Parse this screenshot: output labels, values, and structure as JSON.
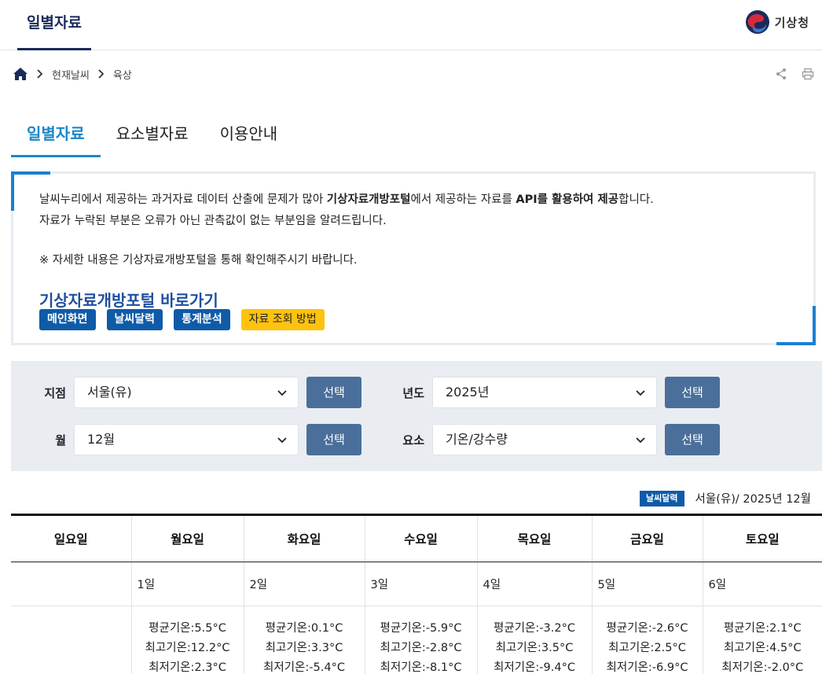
{
  "header": {
    "title": "일별자료",
    "org": "기상청"
  },
  "breadcrumb": {
    "items": [
      "현재날씨",
      "육상"
    ]
  },
  "tabs": [
    {
      "label": "일별자료",
      "active": true
    },
    {
      "label": "요소별자료",
      "active": false
    },
    {
      "label": "이용안내",
      "active": false
    }
  ],
  "notice": {
    "l1_a": "날씨누리에서 제공하는 과거자료 데이터 산출에 문제가 많아 ",
    "l1_b": "기상자료개방포털",
    "l1_c": "에서 제공하는 자료를 ",
    "l1_d": "API를 활용하여 제공",
    "l1_e": "합니다.",
    "l2": "자료가 누락된 부분은 오류가 아닌 관측값이 없는 부분임을 알려드립니다.",
    "l3": "※ 자세한 내용은 기상자료개방포털을 통해 확인해주시기 바랍니다.",
    "portal_title": "기상자료개방포털 바로가기",
    "chips": [
      "메인화면",
      "날씨달력",
      "통계분석",
      "자료 조회 방법"
    ]
  },
  "filter": {
    "station_label": "지점",
    "station_value": "서울(유)",
    "year_label": "년도",
    "year_value": "2025년",
    "month_label": "월",
    "month_value": "12월",
    "element_label": "요소",
    "element_value": "기온/강수량",
    "button_label": "선택"
  },
  "caption": {
    "badge": "날씨달력",
    "text": "서울(유)/ 2025년 12월"
  },
  "calendar": {
    "weekdays": [
      "일요일",
      "월요일",
      "화요일",
      "수요일",
      "목요일",
      "금요일",
      "토요일"
    ],
    "days": [
      "",
      "1일",
      "2일",
      "3일",
      "4일",
      "5일",
      "6일"
    ],
    "weather": [
      {
        "avg": "",
        "max": "",
        "min": ""
      },
      {
        "avg": "평균기온:5.5°C",
        "max": "최고기온:12.2°C",
        "min": "최저기온:2.3°C"
      },
      {
        "avg": "평균기온:0.1°C",
        "max": "최고기온:3.3°C",
        "min": "최저기온:-5.4°C"
      },
      {
        "avg": "평균기온:-5.9°C",
        "max": "최고기온:-2.8°C",
        "min": "최저기온:-8.1°C"
      },
      {
        "avg": "평균기온:-3.2°C",
        "max": "최고기온:3.5°C",
        "min": "최저기온:-9.4°C"
      },
      {
        "avg": "평균기온:-2.6°C",
        "max": "최고기온:2.5°C",
        "min": "최저기온:-6.9°C"
      },
      {
        "avg": "평균기온:2.1°C",
        "max": "최고기온:4.5°C",
        "min": "최저기온:-2.0°C"
      }
    ]
  }
}
